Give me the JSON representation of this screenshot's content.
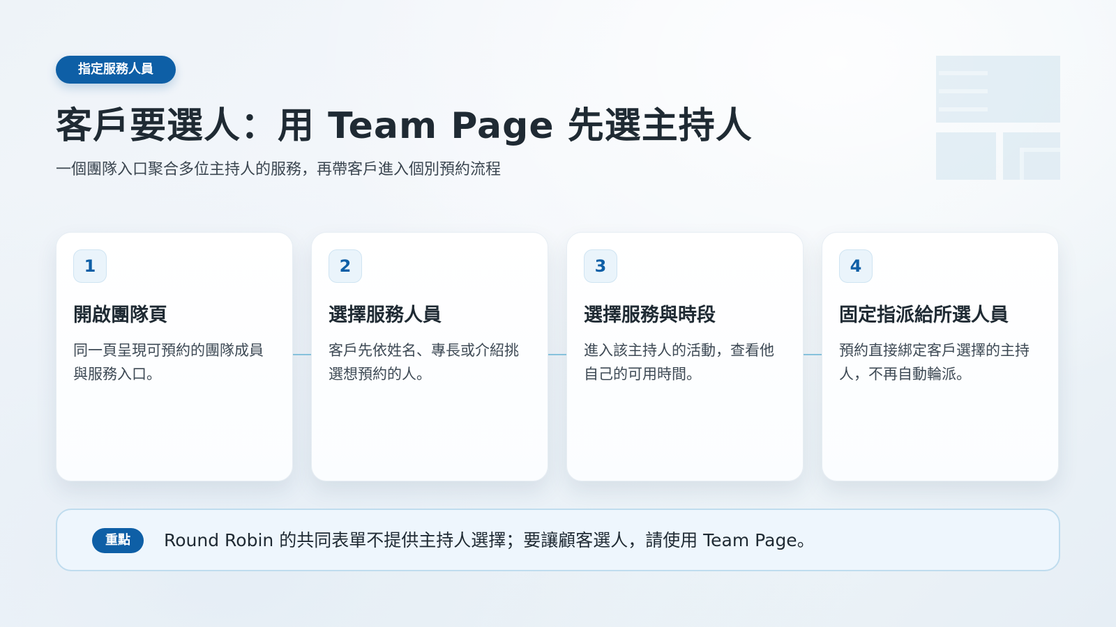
{
  "header": {
    "tag": "指定服務人員",
    "title": "客戶要選人：用 Team Page 先選主持人",
    "subtitle": "一個團隊入口聚合多位主持人的服務，再帶客戶進入個別預約流程"
  },
  "steps": [
    {
      "number": "1",
      "title": "開啟團隊頁",
      "desc": "同一頁呈現可預約的團隊成員與服務入口。"
    },
    {
      "number": "2",
      "title": "選擇服務人員",
      "desc": "客戶先依姓名、專長或介紹挑選想預約的人。"
    },
    {
      "number": "3",
      "title": "選擇服務與時段",
      "desc": "進入該主持人的活動，查看他自己的可用時間。"
    },
    {
      "number": "4",
      "title": "固定指派給所選人員",
      "desc": "預約直接綁定客戶選擇的主持人，不再自動輪派。"
    }
  ],
  "note": {
    "badge": "重點",
    "text": "Round Robin 的共同表單不提供主持人選擇；要讓顧客選人，請使用 Team Page。"
  },
  "colors": {
    "accent": "#0e5fa6",
    "connector": "#8cc8e2",
    "note_background": "#eef6fd",
    "note_border": "#bfdcee"
  }
}
